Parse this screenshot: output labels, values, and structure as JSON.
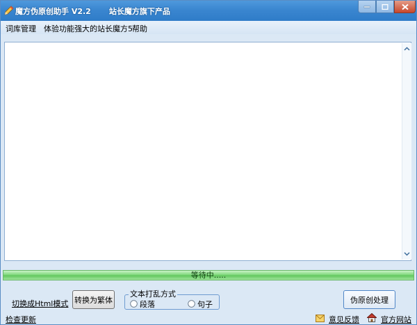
{
  "window": {
    "title": "魔方伪原创助手 V2.2",
    "subtitle": "站长魔方旗下产品"
  },
  "menu": {
    "items": [
      "词库管理",
      "体验功能强大的站长魔方5",
      "帮助"
    ]
  },
  "editor": {
    "value": ""
  },
  "progress": {
    "text": "等待中.....",
    "percent": 100
  },
  "controls": {
    "html_mode_link": "切换成Html模式",
    "traditional_button": "转换为繁体",
    "shuffle_group_label": "文本打乱方式",
    "shuffle_options": [
      "段落",
      "句子"
    ],
    "process_button": "伪原创处理"
  },
  "status": {
    "check_update": "检查更新",
    "feedback": "意见反馈",
    "official_site": "官方网站"
  },
  "icons": {
    "app": "pencil-icon",
    "minimize": "minimize-icon",
    "maximize": "maximize-icon",
    "close": "close-icon",
    "mail": "mail-icon",
    "home": "home-icon"
  },
  "colors": {
    "titlebar": "#3a86d0",
    "window_bg": "#dbe8f5",
    "progress": "#79d676",
    "close_button": "#c7482b"
  }
}
